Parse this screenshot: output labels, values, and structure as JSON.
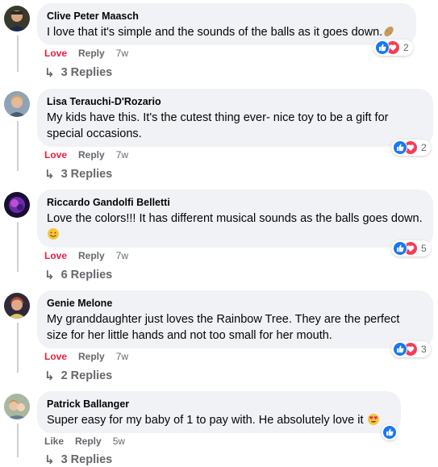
{
  "comments": [
    {
      "author": "Clive Peter Maasch",
      "text": "I love that it's simple and the sounds of the balls as it goes down.",
      "emoji": "potato",
      "like_label": "Love",
      "reply_label": "Reply",
      "time": "7w",
      "reaction_count": "2",
      "replies_label": "3 Replies"
    },
    {
      "author": "Lisa Terauchi-D'Rozario",
      "text": "My kids have this. It's the cutest thing ever- nice toy to be a gift for special occasions.",
      "like_label": "Love",
      "reply_label": "Reply",
      "time": "7w",
      "reaction_count": "2",
      "replies_label": "3 Replies"
    },
    {
      "author": "Riccardo Gandolfi Belletti",
      "text": "Love the colors!!! It has different musical sounds as the balls goes down.",
      "emoji": "smile",
      "like_label": "Love",
      "reply_label": "Reply",
      "time": "7w",
      "reaction_count": "5",
      "replies_label": "6 Replies"
    },
    {
      "author": "Genie Melone",
      "text": "My granddaughter just loves the Rainbow Tree. They are the perfect size for her little hands and not too small for her mouth.",
      "like_label": "Love",
      "reply_label": "Reply",
      "time": "7w",
      "reaction_count": "3",
      "replies_label": "2 Replies"
    },
    {
      "author": "Patrick Ballanger",
      "text": "Super easy for my baby of 1 to pay with. He absolutely love it",
      "emoji": "heart-eyes",
      "like_label": "Like",
      "reply_label": "Reply",
      "time": "5w",
      "replies_label": "3 Replies"
    }
  ],
  "colors": {
    "love_red": "#e41e3f",
    "like_blue": "#1877f2",
    "bubble_bg": "#f0f2f5",
    "muted_text": "#65676b"
  }
}
